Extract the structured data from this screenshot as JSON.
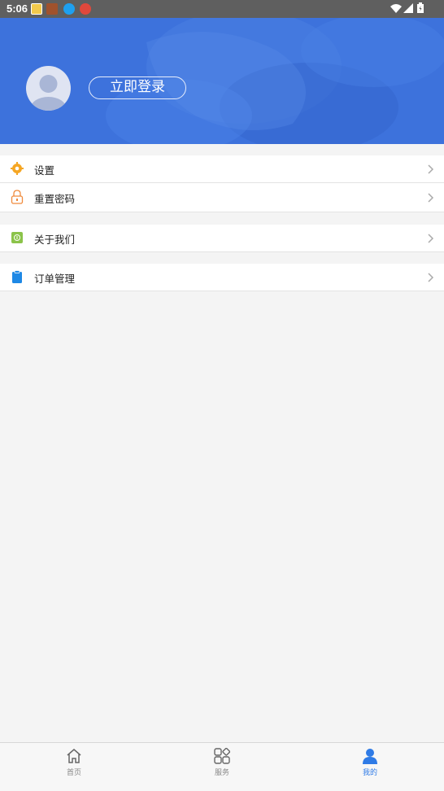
{
  "status_bar": {
    "time": "5:06"
  },
  "header": {
    "login_label": "立即登录"
  },
  "menu": {
    "settings": "设置",
    "reset_password": "重置密码",
    "about_us": "关于我们",
    "order_management": "订单管理"
  },
  "tabs": {
    "home": "首页",
    "services": "服务",
    "mine": "我的",
    "active": "mine"
  },
  "colors": {
    "header_blue": "#3d72dc",
    "accent": "#2f7be6",
    "settings_icon": "#f5a623",
    "reset_icon": "#f08a3c",
    "about_icon": "#8bc34a",
    "order_icon": "#1e88e5"
  }
}
